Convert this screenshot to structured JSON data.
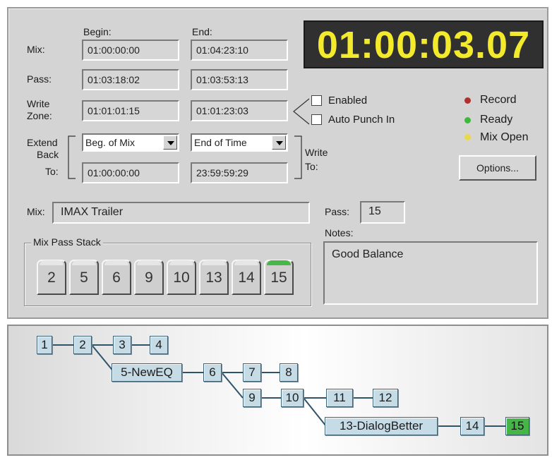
{
  "headers": {
    "begin": "Begin:",
    "end": "End:"
  },
  "rows": {
    "mix": {
      "label": "Mix:",
      "begin": "01:00:00:00",
      "end": "01:04:23:10"
    },
    "pass": {
      "label": "Pass:",
      "begin": "01:03:18:02",
      "end": "01:03:53:13"
    },
    "write_zone": {
      "label_line1": "Write",
      "label_line2": "Zone:",
      "begin": "01:01:01:15",
      "end": "01:01:23:03"
    }
  },
  "extend": {
    "label_line1": "Extend",
    "label_line2": "Back",
    "label_line3": "To:",
    "begin_select": "Beg. of Mix",
    "end_select": "End of Time",
    "begin_value": "01:00:00:00",
    "end_value": "23:59:59:29",
    "write_label_line1": "Write",
    "write_label_line2": "To:"
  },
  "timecode": "01:00:03.07",
  "options": {
    "enabled": "Enabled",
    "auto_punch": "Auto Punch In"
  },
  "status": [
    {
      "label": "Record",
      "color": "#b03030"
    },
    {
      "label": "Ready",
      "color": "#3fb83f"
    },
    {
      "label": "Mix Open",
      "color": "#e8d84a"
    }
  ],
  "options_button": "Options...",
  "mix_name": {
    "label": "Mix:",
    "value": "IMAX Trailer"
  },
  "pass_number": {
    "label": "Pass:",
    "value": "15"
  },
  "notes": {
    "label": "Notes:",
    "value": "Good Balance"
  },
  "stack": {
    "title": "Mix Pass Stack",
    "tabs": [
      "2",
      "5",
      "6",
      "9",
      "10",
      "13",
      "14",
      "15"
    ],
    "active": "15"
  },
  "tree": {
    "nodes": [
      "1",
      "2",
      "3",
      "4",
      "5-NewEQ",
      "6",
      "7",
      "8",
      "9",
      "10",
      "11",
      "12",
      "13-DialogBetter",
      "14",
      "15"
    ],
    "active": "15",
    "active_color": "#45b548"
  }
}
